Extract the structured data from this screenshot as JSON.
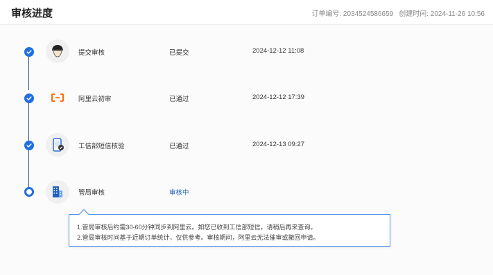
{
  "header": {
    "title": "审核进度",
    "order_label": "订单编号: 2034524586659",
    "created_label": "创建时间: 2024-11-26 10:56"
  },
  "steps": [
    {
      "label": "提交审核",
      "status": "已提交",
      "time": "2024-12-12 11:08",
      "state": "done",
      "icon": "user-avatar-icon"
    },
    {
      "label": "阿里云初审",
      "status": "已通过",
      "time": "2024-12-12 17:39",
      "state": "done",
      "icon": "aliyun-logo-icon"
    },
    {
      "label": "工信部短信核验",
      "status": "已通过",
      "time": "2024-12-13 09:27",
      "state": "done",
      "icon": "phone-verify-icon"
    },
    {
      "label": "管局审核",
      "status": "审核中",
      "time": "",
      "state": "active",
      "icon": "building-icon"
    }
  ],
  "tooltip": {
    "line1": "1.管局审核后约需30-60分钟同步到阿里云。如您已收到工信部短信，请稍后再来查询。",
    "line2": "2.管局审核时间基于近期订单统计，仅供参考。审核期间，阿里云无法催审或撤回申请。"
  },
  "colors": {
    "accent": "#1f6fe0",
    "aliyun_orange": "#ff6a00",
    "active_text": "#1f5fc0"
  }
}
